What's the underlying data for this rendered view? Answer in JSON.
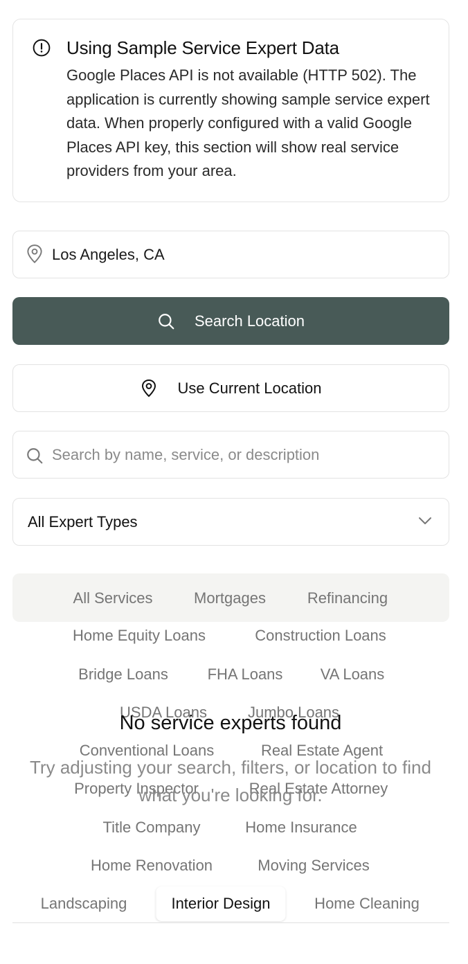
{
  "alert": {
    "icon": "alert-circle-icon",
    "title": "Using Sample Service Expert Data",
    "body": "Google Places API is not available (HTTP 502). The application is currently showing sample service expert data. When properly configured with a valid Google Places API key, this section will show real service providers from your area."
  },
  "location": {
    "icon": "map-pin-icon",
    "value": "Los Angeles, CA"
  },
  "search_location_button": {
    "icon": "search-icon",
    "label": "Search Location",
    "color": "#485a57"
  },
  "current_location_button": {
    "icon": "locate-pin-icon",
    "label": "Use Current Location"
  },
  "search": {
    "icon": "search-icon",
    "placeholder": "Search by name, service, or description",
    "value": ""
  },
  "expert_type_select": {
    "selected": "All Expert Types",
    "icon": "chevron-down-icon"
  },
  "tabs": [
    "All Services",
    "Mortgages",
    "Refinancing",
    "Home Equity Loans",
    "Construction Loans",
    "Bridge Loans",
    "FHA Loans",
    "VA Loans",
    "USDA Loans",
    "Jumbo Loans",
    "Conventional Loans",
    "Real Estate Agent",
    "Property Inspector",
    "Real Estate Attorney",
    "Title Company",
    "Home Insurance",
    "Home Renovation",
    "Moving Services",
    "Landscaping",
    "Interior Design",
    "Home Cleaning"
  ],
  "active_tab": "Interior Design",
  "empty_state": {
    "title": "No service experts found",
    "description": "Try adjusting your search, filters, or location to find what you're looking for."
  }
}
